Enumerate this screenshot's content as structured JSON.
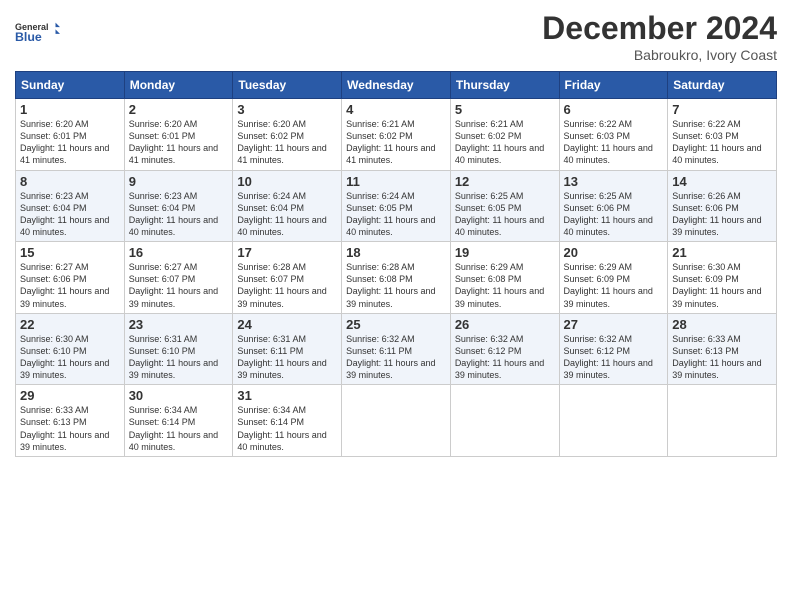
{
  "logo": {
    "general": "General",
    "blue": "Blue"
  },
  "title": "December 2024",
  "location": "Babroukro, Ivory Coast",
  "days_of_week": [
    "Sunday",
    "Monday",
    "Tuesday",
    "Wednesday",
    "Thursday",
    "Friday",
    "Saturday"
  ],
  "weeks": [
    [
      {
        "day": "1",
        "sunrise": "6:20 AM",
        "sunset": "6:01 PM",
        "daylight": "11 hours and 41 minutes."
      },
      {
        "day": "2",
        "sunrise": "6:20 AM",
        "sunset": "6:01 PM",
        "daylight": "11 hours and 41 minutes."
      },
      {
        "day": "3",
        "sunrise": "6:20 AM",
        "sunset": "6:02 PM",
        "daylight": "11 hours and 41 minutes."
      },
      {
        "day": "4",
        "sunrise": "6:21 AM",
        "sunset": "6:02 PM",
        "daylight": "11 hours and 41 minutes."
      },
      {
        "day": "5",
        "sunrise": "6:21 AM",
        "sunset": "6:02 PM",
        "daylight": "11 hours and 40 minutes."
      },
      {
        "day": "6",
        "sunrise": "6:22 AM",
        "sunset": "6:03 PM",
        "daylight": "11 hours and 40 minutes."
      },
      {
        "day": "7",
        "sunrise": "6:22 AM",
        "sunset": "6:03 PM",
        "daylight": "11 hours and 40 minutes."
      }
    ],
    [
      {
        "day": "8",
        "sunrise": "6:23 AM",
        "sunset": "6:04 PM",
        "daylight": "11 hours and 40 minutes."
      },
      {
        "day": "9",
        "sunrise": "6:23 AM",
        "sunset": "6:04 PM",
        "daylight": "11 hours and 40 minutes."
      },
      {
        "day": "10",
        "sunrise": "6:24 AM",
        "sunset": "6:04 PM",
        "daylight": "11 hours and 40 minutes."
      },
      {
        "day": "11",
        "sunrise": "6:24 AM",
        "sunset": "6:05 PM",
        "daylight": "11 hours and 40 minutes."
      },
      {
        "day": "12",
        "sunrise": "6:25 AM",
        "sunset": "6:05 PM",
        "daylight": "11 hours and 40 minutes."
      },
      {
        "day": "13",
        "sunrise": "6:25 AM",
        "sunset": "6:06 PM",
        "daylight": "11 hours and 40 minutes."
      },
      {
        "day": "14",
        "sunrise": "6:26 AM",
        "sunset": "6:06 PM",
        "daylight": "11 hours and 39 minutes."
      }
    ],
    [
      {
        "day": "15",
        "sunrise": "6:27 AM",
        "sunset": "6:06 PM",
        "daylight": "11 hours and 39 minutes."
      },
      {
        "day": "16",
        "sunrise": "6:27 AM",
        "sunset": "6:07 PM",
        "daylight": "11 hours and 39 minutes."
      },
      {
        "day": "17",
        "sunrise": "6:28 AM",
        "sunset": "6:07 PM",
        "daylight": "11 hours and 39 minutes."
      },
      {
        "day": "18",
        "sunrise": "6:28 AM",
        "sunset": "6:08 PM",
        "daylight": "11 hours and 39 minutes."
      },
      {
        "day": "19",
        "sunrise": "6:29 AM",
        "sunset": "6:08 PM",
        "daylight": "11 hours and 39 minutes."
      },
      {
        "day": "20",
        "sunrise": "6:29 AM",
        "sunset": "6:09 PM",
        "daylight": "11 hours and 39 minutes."
      },
      {
        "day": "21",
        "sunrise": "6:30 AM",
        "sunset": "6:09 PM",
        "daylight": "11 hours and 39 minutes."
      }
    ],
    [
      {
        "day": "22",
        "sunrise": "6:30 AM",
        "sunset": "6:10 PM",
        "daylight": "11 hours and 39 minutes."
      },
      {
        "day": "23",
        "sunrise": "6:31 AM",
        "sunset": "6:10 PM",
        "daylight": "11 hours and 39 minutes."
      },
      {
        "day": "24",
        "sunrise": "6:31 AM",
        "sunset": "6:11 PM",
        "daylight": "11 hours and 39 minutes."
      },
      {
        "day": "25",
        "sunrise": "6:32 AM",
        "sunset": "6:11 PM",
        "daylight": "11 hours and 39 minutes."
      },
      {
        "day": "26",
        "sunrise": "6:32 AM",
        "sunset": "6:12 PM",
        "daylight": "11 hours and 39 minutes."
      },
      {
        "day": "27",
        "sunrise": "6:32 AM",
        "sunset": "6:12 PM",
        "daylight": "11 hours and 39 minutes."
      },
      {
        "day": "28",
        "sunrise": "6:33 AM",
        "sunset": "6:13 PM",
        "daylight": "11 hours and 39 minutes."
      }
    ],
    [
      {
        "day": "29",
        "sunrise": "6:33 AM",
        "sunset": "6:13 PM",
        "daylight": "11 hours and 39 minutes."
      },
      {
        "day": "30",
        "sunrise": "6:34 AM",
        "sunset": "6:14 PM",
        "daylight": "11 hours and 40 minutes."
      },
      {
        "day": "31",
        "sunrise": "6:34 AM",
        "sunset": "6:14 PM",
        "daylight": "11 hours and 40 minutes."
      },
      null,
      null,
      null,
      null
    ]
  ],
  "labels": {
    "sunrise": "Sunrise:",
    "sunset": "Sunset:",
    "daylight": "Daylight:"
  }
}
